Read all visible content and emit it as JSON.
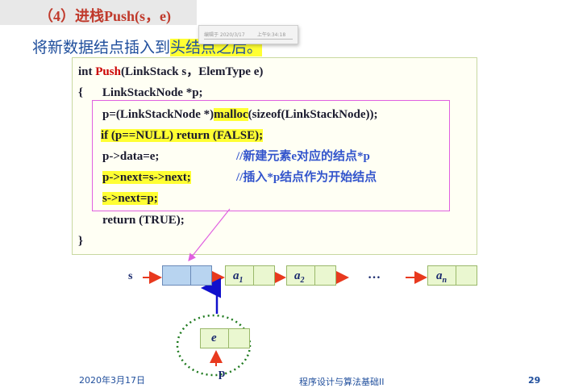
{
  "slide": {
    "title": "（4）进栈Push(s，e)",
    "subtitle_part1": "将新数据结点插入到",
    "subtitle_part2": "头结点之后。",
    "popup": {
      "date": "编辑于 2020/3/17",
      "time": "上午9:34:18"
    }
  },
  "code": {
    "line1_type": "int ",
    "line1_func": "Push",
    "line1_args": "(LinkStack  s，ElemType e)",
    "line2_brace": "{",
    "line2_decl": "LinkStackNode *p;",
    "line3_a": "p=(LinkStackNode *)",
    "line3_b": "malloc",
    "line3_c": "(sizeof(LinkStackNode));",
    "line4": " if (p==NULL) return (FALSE);",
    "line5_code": "p->data=e;",
    "line5_comment": "//新建元素e对应的结点*p",
    "line6_code": "p->next=s->next;",
    "line6_comment": "//插入*p结点作为开始结点",
    "line7": "s->next=p;",
    "line8": "return (TRUE);",
    "line9": "}"
  },
  "diagram": {
    "s_label": "s",
    "nodes": [
      {
        "letter": "a",
        "sub": "1"
      },
      {
        "letter": "a",
        "sub": "2"
      },
      {
        "letter": "a",
        "sub": "n"
      }
    ],
    "ellipsis": "…",
    "new_node_value": "e",
    "p_label": "p"
  },
  "footer": {
    "date": "2020年3月17日",
    "course": "程序设计与算法基础II",
    "page": "29"
  },
  "colors": {
    "title": "#c0392b",
    "text_blue": "#1f4e9c",
    "highlight": "#ffff33",
    "arrow_red": "#e8391e",
    "arrow_blue": "#1010cc",
    "magenta": "#e060e0",
    "dotted_green": "#1f7a1f"
  }
}
